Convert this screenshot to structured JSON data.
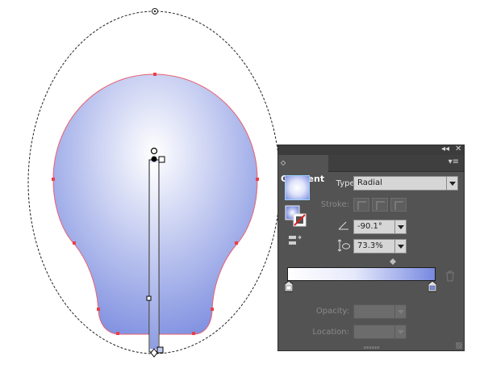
{
  "artwork": {
    "gradient_colors": {
      "center": "#ffffff",
      "edge": "#7e8fe0"
    },
    "anchor_color": "#e8404a",
    "path_color": "#e86070"
  },
  "panel": {
    "title": "Gradient",
    "type_label": "Type:",
    "type_value": "Radial",
    "stroke_label": "Stroke:",
    "angle_value": "-90.1°",
    "aspect_value": "73.3%",
    "opacity_label": "Opacity:",
    "opacity_value": "",
    "location_label": "Location:",
    "location_value": "",
    "collapse_icon": "double-chevron-icon",
    "close_icon": "close-icon",
    "menu_icon": "panel-menu-icon",
    "trash_icon": "trash-icon",
    "stops": {
      "start_color": "#ffffff",
      "end_color": "#7789e0",
      "midpoint_percent": 71
    }
  }
}
